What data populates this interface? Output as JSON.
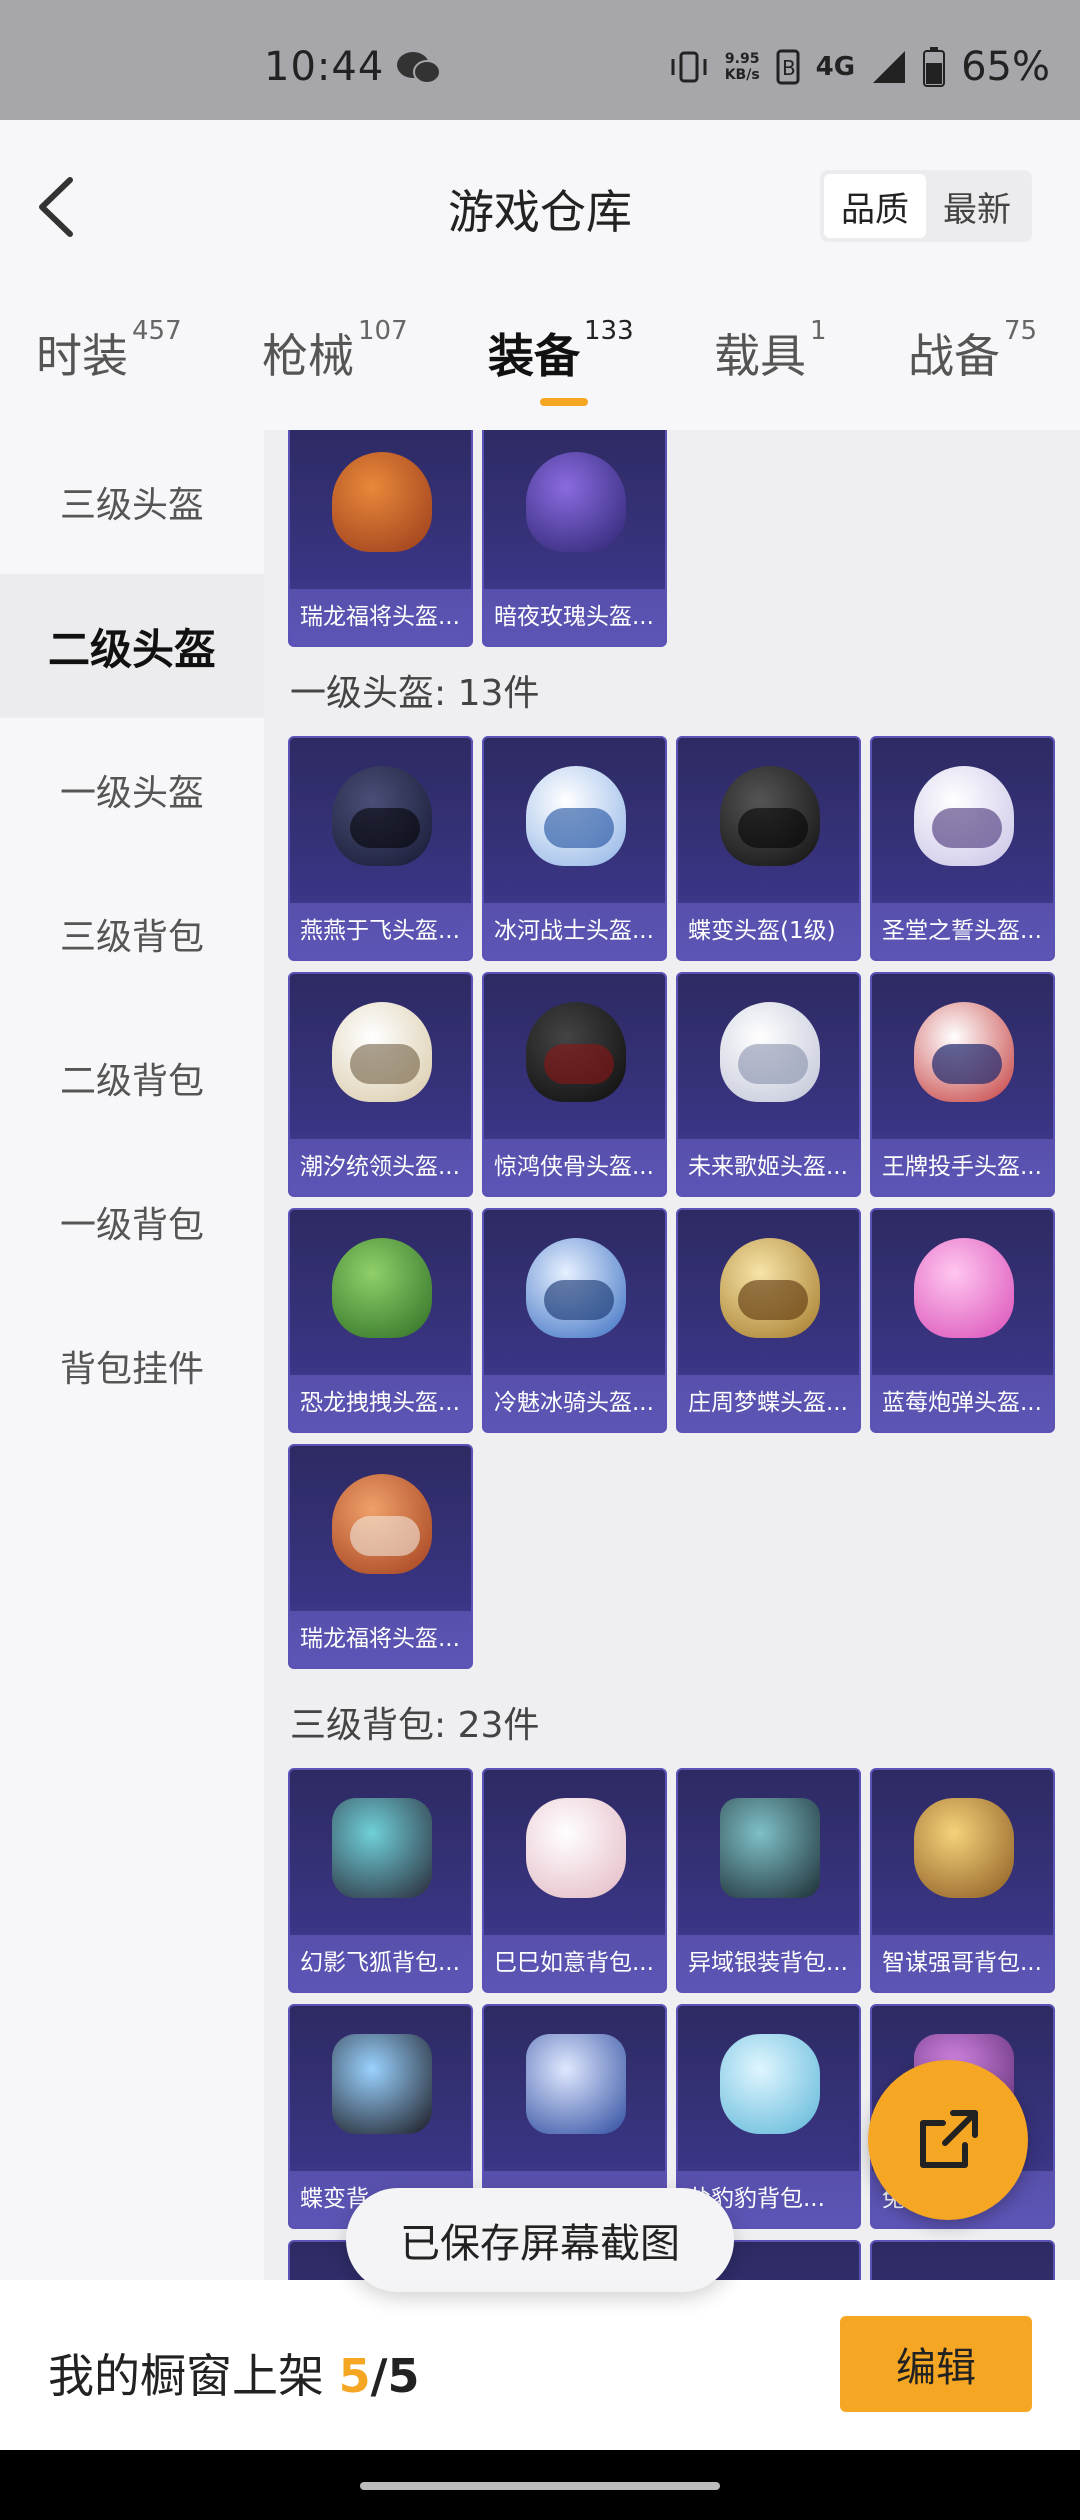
{
  "status_bar": {
    "time": "10:44",
    "net_speed": "9.95",
    "net_unit": "KB/s",
    "signal": "4G",
    "battery": "65%"
  },
  "header": {
    "title": "游戏仓库",
    "sort": {
      "quality": "品质",
      "newest": "最新"
    }
  },
  "tabs": [
    {
      "label": "时装",
      "count": "457"
    },
    {
      "label": "枪械",
      "count": "107"
    },
    {
      "label": "装备",
      "count": "133"
    },
    {
      "label": "载具",
      "count": "1"
    },
    {
      "label": "战备",
      "count": "75"
    }
  ],
  "sidebar": [
    {
      "label": "三级头盔"
    },
    {
      "label": "二级头盔"
    },
    {
      "label": "一级头盔"
    },
    {
      "label": "三级背包"
    },
    {
      "label": "二级背包"
    },
    {
      "label": "一级背包"
    },
    {
      "label": "背包挂件"
    }
  ],
  "content": {
    "top_items": [
      "瑞龙福将头盔...",
      "暗夜玫瑰头盔..."
    ],
    "level1_title": "一级头盔: 13件",
    "level1_items": [
      "燕燕于飞头盔...",
      "冰河战士头盔...",
      "蝶变头盔(1级)",
      "圣堂之誓头盔...",
      "潮汐统领头盔...",
      "惊鸿侠骨头盔...",
      "未来歌姬头盔...",
      "王牌投手头盔...",
      "恐龙拽拽头盔...",
      "冷魅冰骑头盔...",
      "庄周梦蝶头盔...",
      "蓝莓炮弹头盔...",
      "瑞龙福将头盔..."
    ],
    "bag3_title": "三级背包: 23件",
    "bag3_items": [
      "幻影飞狐背包...",
      "巳巳如意背包...",
      "异域银装背包...",
      "智谋强哥背包...",
      "蝶变背",
      "",
      "盐豹豹背包...",
      "兔"
    ]
  },
  "bottom": {
    "shelf_label": "我的橱窗上架",
    "shelf_current": "5",
    "shelf_sep": "/",
    "shelf_total": "5",
    "edit": "编辑"
  },
  "toast": "已保存屏幕截图",
  "colors": {
    "accent": "#f5a623",
    "card_bg": "#3a3583"
  },
  "icons": {
    "back": "chevron-left-icon",
    "share": "share-external-icon",
    "wechat": "wechat-icon"
  }
}
